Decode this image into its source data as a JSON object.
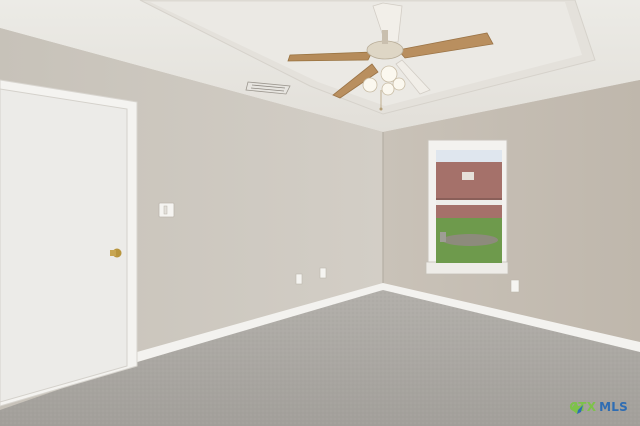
{
  "watermark": {
    "brand_left": "CTX",
    "brand_right": "MLS"
  },
  "colors": {
    "ceiling": "#e9e6e0",
    "wall_left": "#cdc8c0",
    "wall_back": "#c2bbb1",
    "carpet": "#a9a6a1",
    "trim": "#f2f1ee",
    "door": "#ecebe8",
    "brand_green": "#7dc24a",
    "brand_blue": "#2f6db3"
  },
  "icons": [
    "ceiling-fan-icon",
    "hvac-vent-icon",
    "light-switch-icon",
    "outlet-icon",
    "door-knob-icon",
    "logo-icon"
  ]
}
